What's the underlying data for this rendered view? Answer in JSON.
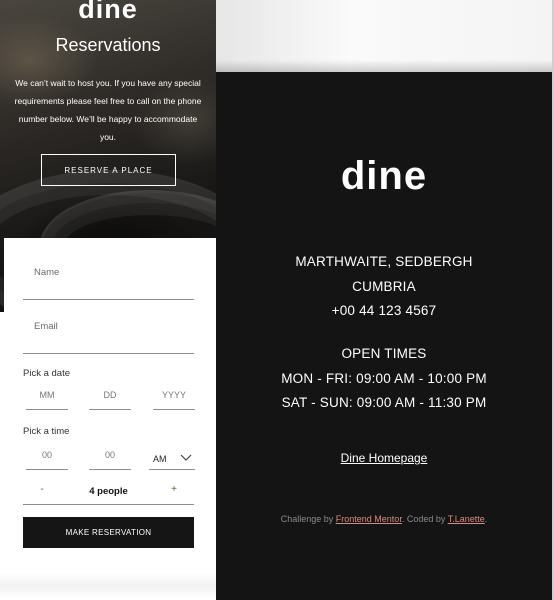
{
  "hero": {
    "logo": "dine",
    "title": "Reservations",
    "description": "We can’t wait to host you. If you have any special requirements please feel free to call on the phone number below. We’ll be happy to accommodate you.",
    "reserve_button": "RESERVE A PLACE"
  },
  "form": {
    "name_placeholder": "Name",
    "email_placeholder": "Email",
    "date_label": "Pick a date",
    "date_fields": {
      "month": "MM",
      "day": "DD",
      "year": "YYYY"
    },
    "time_label": "Pick a time",
    "time_fields": {
      "hour": "00",
      "minute": "00",
      "period": "AM"
    },
    "people": {
      "minus": "-",
      "value": "4 people",
      "plus": "+"
    },
    "submit_button": "MAKE RESERVATION"
  },
  "footer": {
    "logo": "dine",
    "address_line1": "MARTHWAITE, SEDBERGH",
    "address_line2": "CUMBRIA",
    "phone": "+00 44 123 4567",
    "open_times_heading": "OPEN TIMES",
    "weekday_hours": "MON - FRI: 09:00 AM - 10:00 PM",
    "weekend_hours": "SAT - SUN: 09:00 AM - 11:30 PM",
    "homepage_link": "Dine Homepage",
    "credit": {
      "prefix": "Challenge by ",
      "challenge_link": "Frontend Mentor",
      "middle": ". Coded by ",
      "author_link": "T.Lanette",
      "suffix": "."
    }
  },
  "colors": {
    "dark": "#141414",
    "credit_link": "#d98a83",
    "field_line": "#8d8d8d"
  }
}
